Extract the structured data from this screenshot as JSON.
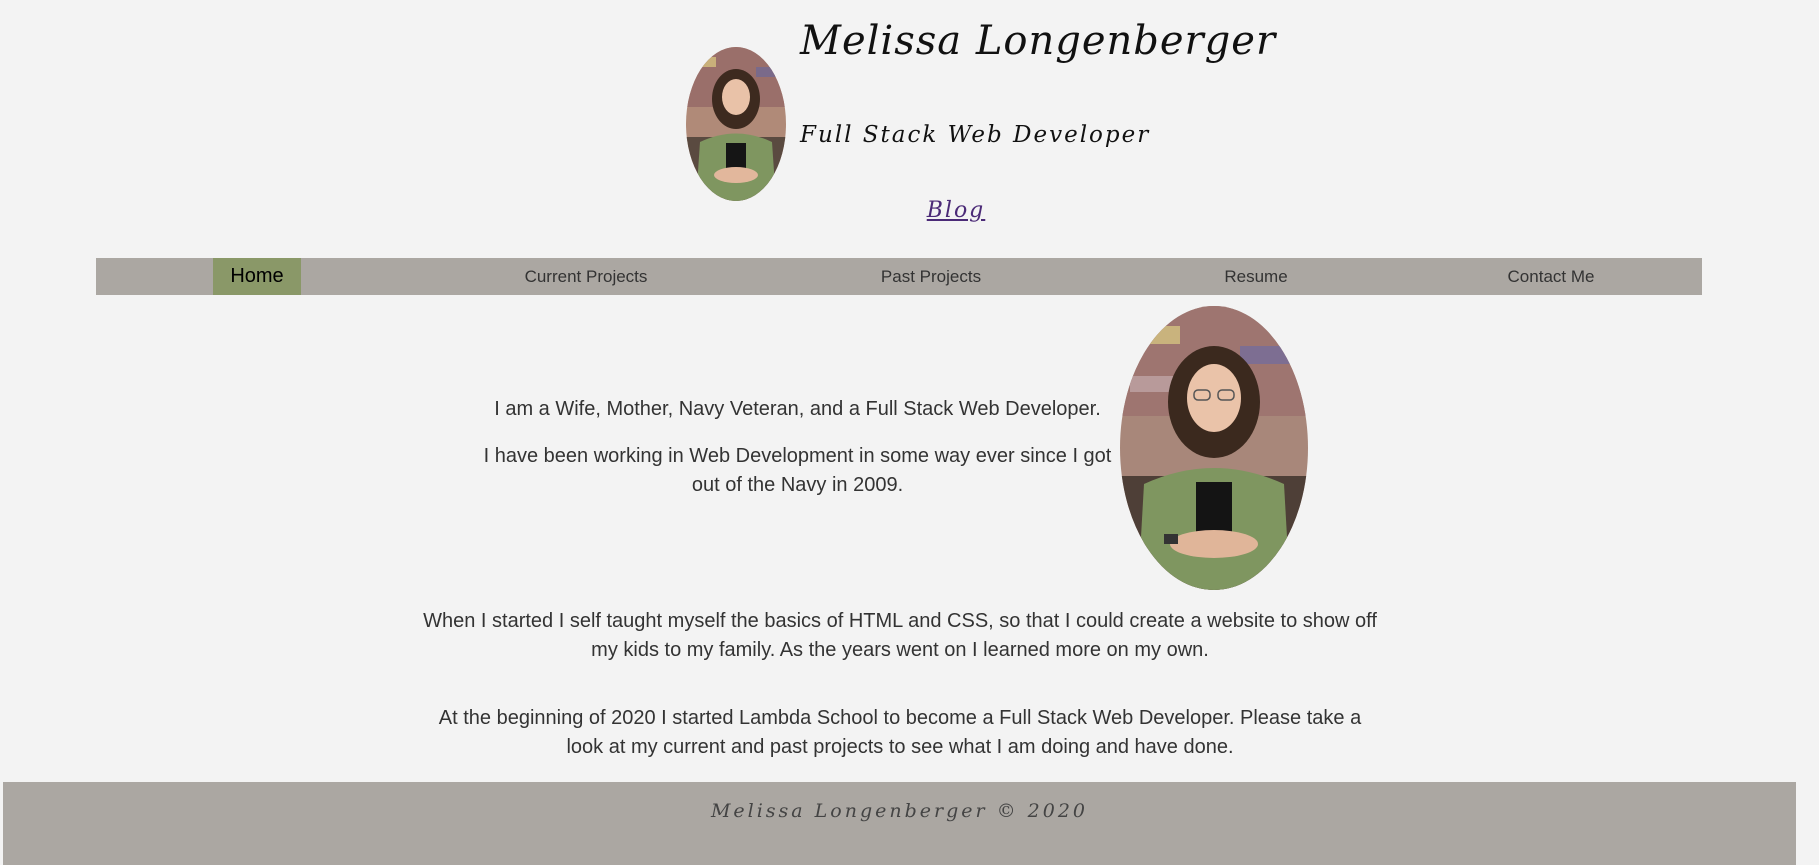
{
  "header": {
    "title": "Melissa Longenberger",
    "subtitle": "Full Stack Web Developer",
    "blog_link": "Blog"
  },
  "nav": {
    "items": [
      {
        "label": "Home",
        "active": true
      },
      {
        "label": "Current Projects",
        "active": false
      },
      {
        "label": "Past Projects",
        "active": false
      },
      {
        "label": "Resume",
        "active": false
      },
      {
        "label": "Contact Me",
        "active": false
      }
    ]
  },
  "main": {
    "paragraphs": [
      "I am a Wife, Mother, Navy Veteran, and a Full Stack Web Developer.",
      "I have been working in Web Development in some way ever since I got out of the Navy in 2009.",
      "When I started I self taught myself the basics of HTML and CSS, so that I could create a website to show off my kids to my family. As the years went on I learned more on my own.",
      "At the beginning of 2020 I started Lambda School to become a Full Stack Web Developer. Please take a look at my current and past projects to see what I am doing and have done."
    ]
  },
  "footer": {
    "text": "Melissa Longenberger © 2020"
  },
  "colors": {
    "background": "#f3f3f3",
    "nav_bg": "#aba7a2",
    "nav_active": "#8a9868",
    "footer_bg": "#aba7a2",
    "link": "#4b2a77"
  }
}
